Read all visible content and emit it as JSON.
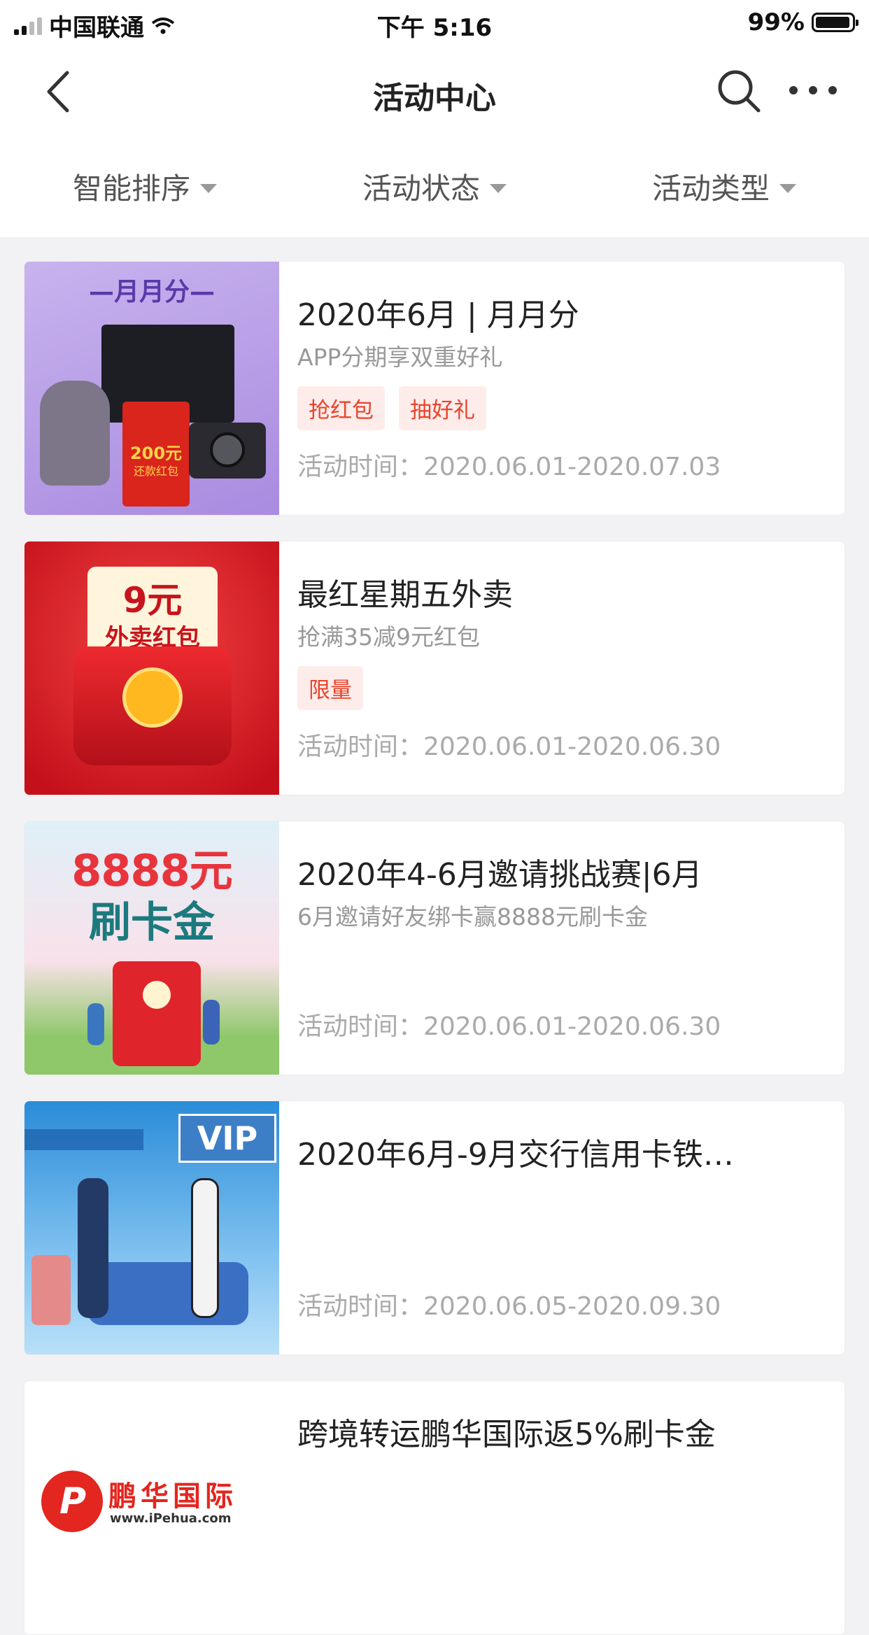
{
  "status_bar": {
    "carrier": "中国联通",
    "time": "下午 5:16",
    "battery": "99%"
  },
  "nav": {
    "title": "活动中心"
  },
  "filters": [
    {
      "label": "智能排序"
    },
    {
      "label": "活动状态"
    },
    {
      "label": "活动类型"
    }
  ],
  "cards": [
    {
      "title": "2020年6月 | 月月分",
      "subtitle": "APP分期享双重好礼",
      "tags": [
        "抢红包",
        "抽好礼"
      ],
      "time": "活动时间：2020.06.01-2020.07.03",
      "thumb": {
        "heading": "—月月分—",
        "badge": "200元",
        "badge_sub": "还款红包"
      }
    },
    {
      "title": "最红星期五外卖",
      "subtitle": "抢满35减9元红包",
      "tags": [
        "限量"
      ],
      "time": "活动时间：2020.06.01-2020.06.30",
      "thumb": {
        "line1": "9元",
        "line2": "外卖红包"
      }
    },
    {
      "title": "2020年4-6月邀请挑战赛|6月",
      "subtitle": "6月邀请好友绑卡赢8888元刷卡金",
      "tags": [],
      "time": "活动时间：2020.06.01-2020.06.30",
      "thumb": {
        "line1": "8888元",
        "line2": "刷卡金"
      }
    },
    {
      "title": "2020年6月-9月交行信用卡铁…",
      "subtitle": "",
      "tags": [],
      "time": "活动时间：2020.06.05-2020.09.30",
      "thumb": {
        "badge": "VIP"
      }
    },
    {
      "title": "跨境转运鹏华国际返5%刷卡金",
      "subtitle": "",
      "tags": [],
      "time": "",
      "thumb": {
        "logo_text": "鹏华国际",
        "logo_url": "www.iPehua.com"
      }
    }
  ]
}
